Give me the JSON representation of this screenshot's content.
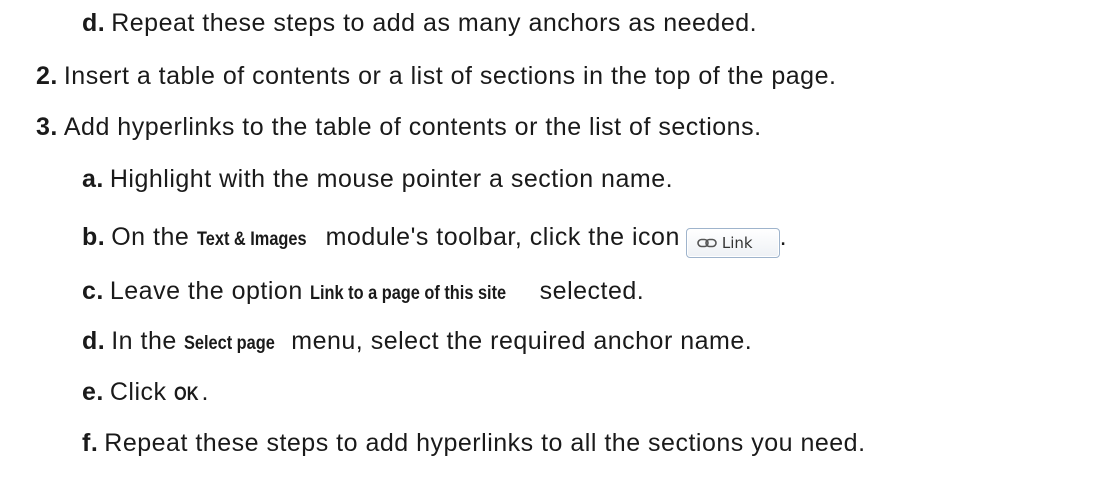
{
  "lines": [
    {
      "num": "d.",
      "text": "Repeat these steps to add as many anchors as needed."
    },
    {
      "num": "2.",
      "text": "Insert a table of contents or a list of sections in the top of the page."
    },
    {
      "num": "3.",
      "text": "Add hyperlinks to the table of contents or the list of sections."
    },
    {
      "num": "a.",
      "text": "Highlight with the mouse pointer a section name."
    },
    {
      "num": "b.",
      "before": "On the ",
      "ui": "Text & Images",
      "after": " module's toolbar, click the icon",
      "end": "."
    },
    {
      "num": "c.",
      "before": "Leave the option ",
      "ui": "Link to a page of this site",
      "after": " selected."
    },
    {
      "num": "d.",
      "before": "In the ",
      "ui": "Select page",
      "after": " menu, select the required anchor name."
    },
    {
      "num": "e.",
      "before": "Click ",
      "ui": "OK",
      "after": "."
    },
    {
      "num": "f.",
      "text": "Repeat these steps to add hyperlinks to all the sections you need."
    }
  ],
  "link_button": {
    "label": "Link",
    "icon": "chain-link-icon"
  }
}
